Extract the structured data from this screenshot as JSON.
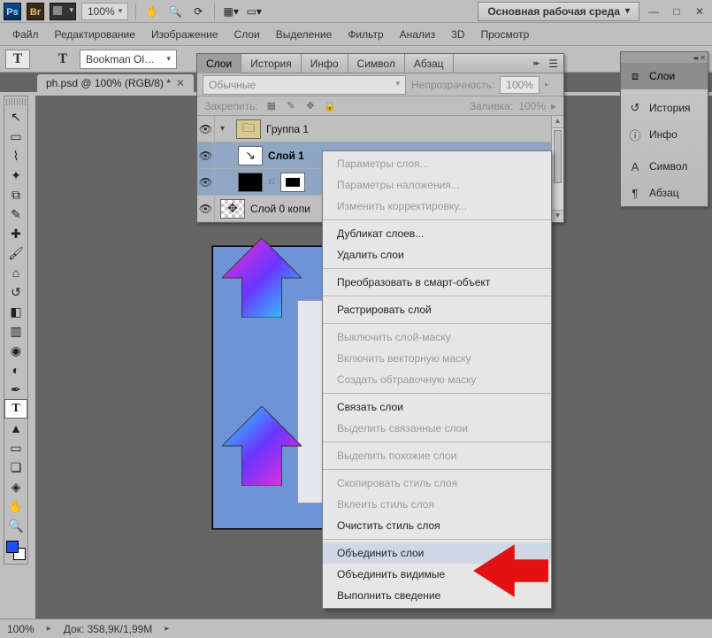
{
  "titlebar": {
    "zoom_label": "100%",
    "workspace_label": "Основная рабочая среда"
  },
  "mainmenu": {
    "items": [
      "Файл",
      "Редактирование",
      "Изображение",
      "Слои",
      "Выделение",
      "Фильтр",
      "Анализ",
      "3D",
      "Просмотр"
    ]
  },
  "optbar": {
    "tool_letter": "T",
    "orient_letter": "T",
    "font_family": "Bookman Ol…"
  },
  "document_tab": {
    "label": "ph.psd @ 100% (RGB/8) *"
  },
  "layerspanel": {
    "tabs": [
      "Слои",
      "История",
      "Инфо",
      "Символ",
      "Абзац"
    ],
    "blend_mode": "Обычные",
    "opacity_label": "Непрозрачность:",
    "opacity_value": "100%",
    "lock_label": "Закрепить:",
    "fill_label": "Заливка:",
    "fill_value": "100%",
    "layers": {
      "group_name": "Группа 1",
      "layer1_name": "Слой 1",
      "adj_name": "",
      "copy_name": "Слой 0 копи"
    }
  },
  "context_menu": {
    "items": [
      {
        "label": "Параметры слоя...",
        "disabled": true
      },
      {
        "label": "Параметры наложения...",
        "disabled": true
      },
      {
        "label": "Изменить корректировку...",
        "disabled": true
      },
      {
        "sep": true
      },
      {
        "label": "Дубликат слоев...",
        "disabled": false
      },
      {
        "label": "Удалить слои",
        "disabled": false
      },
      {
        "sep": true
      },
      {
        "label": "Преобразовать в смарт-объект",
        "disabled": false
      },
      {
        "sep": true
      },
      {
        "label": "Растрировать слой",
        "disabled": false
      },
      {
        "sep": true
      },
      {
        "label": "Выключить слой-маску",
        "disabled": true
      },
      {
        "label": "Включить векторную маску",
        "disabled": true
      },
      {
        "label": "Создать обтравочную маску",
        "disabled": true
      },
      {
        "sep": true
      },
      {
        "label": "Связать слои",
        "disabled": false
      },
      {
        "label": "Выделить связанные слои",
        "disabled": true
      },
      {
        "sep": true
      },
      {
        "label": "Выделить похожие слои",
        "disabled": true
      },
      {
        "sep": true
      },
      {
        "label": "Скопировать стиль слоя",
        "disabled": true
      },
      {
        "label": "Вклеить стиль слоя",
        "disabled": true
      },
      {
        "label": "Очистить стиль слоя",
        "disabled": false
      },
      {
        "sep": true
      },
      {
        "label": "Объединить слои",
        "disabled": false,
        "highlight": true
      },
      {
        "label": "Объединить видимые",
        "disabled": false
      },
      {
        "label": "Выполнить сведение",
        "disabled": false
      }
    ]
  },
  "right_panels": {
    "items": [
      {
        "icon": "⧈",
        "label": "Слои",
        "active": true
      },
      {
        "icon": "↺",
        "label": "История"
      },
      {
        "icon": "ⓘ",
        "label": "Инфо"
      },
      {
        "icon": "A",
        "label": "Символ"
      },
      {
        "icon": "¶",
        "label": "Абзац"
      }
    ]
  },
  "statusbar": {
    "zoom": "100%",
    "doc_label": "Док: 358,9К/1,99М"
  }
}
